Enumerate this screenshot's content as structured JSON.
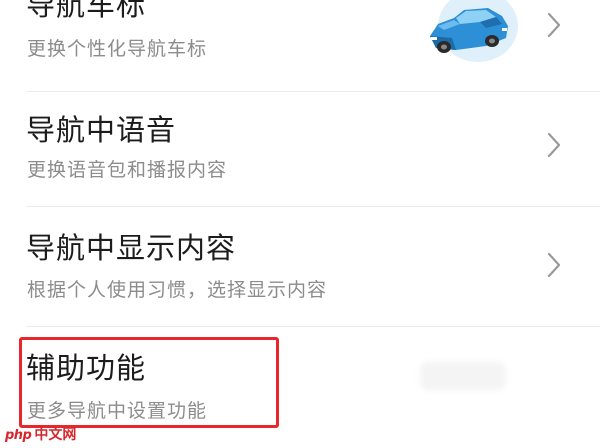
{
  "settings": {
    "items": [
      {
        "title": "导航车标",
        "subtitle": "更换个性化导航车标",
        "has_chevron": true,
        "icon": "car-icon"
      },
      {
        "title": "导航中语音",
        "subtitle": "更换语音包和播报内容",
        "has_chevron": true
      },
      {
        "title": "导航中显示内容",
        "subtitle": "根据个人使用习惯，选择显示内容",
        "has_chevron": true
      },
      {
        "title": "辅助功能",
        "subtitle": "更多导航中设置功能",
        "has_chevron": false,
        "highlighted": true
      }
    ]
  },
  "colors": {
    "title": "#1c1c1c",
    "subtitle": "#8c8c8c",
    "chevron": "#9a9a9a",
    "highlight": "#e8262b",
    "car_body": "#2d8fd6",
    "car_circle": "#dff0fb"
  },
  "watermark": {
    "logo": "php",
    "text": "中文网"
  }
}
